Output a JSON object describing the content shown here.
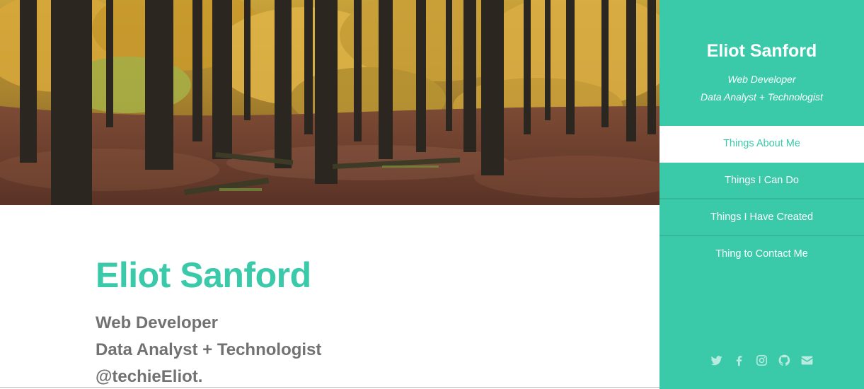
{
  "main": {
    "name": "Eliot Sanford",
    "lines": [
      "Web Developer",
      "Data Analyst + Technologist",
      "@techieEliot."
    ]
  },
  "sidebar": {
    "name": "Eliot Sanford",
    "roles": [
      "Web Developer",
      "Data Analyst + Technologist"
    ],
    "nav": [
      {
        "label": "Things About Me",
        "active": true
      },
      {
        "label": "Things I Can Do",
        "active": false
      },
      {
        "label": "Things I Have Created",
        "active": false
      },
      {
        "label": "Thing to Contact Me",
        "active": false
      }
    ],
    "social": [
      "twitter-icon",
      "facebook-icon",
      "instagram-icon",
      "github-icon",
      "envelope-icon"
    ]
  },
  "colors": {
    "accent": "#3ac9a9",
    "text_gray": "#727272",
    "white": "#ffffff"
  }
}
